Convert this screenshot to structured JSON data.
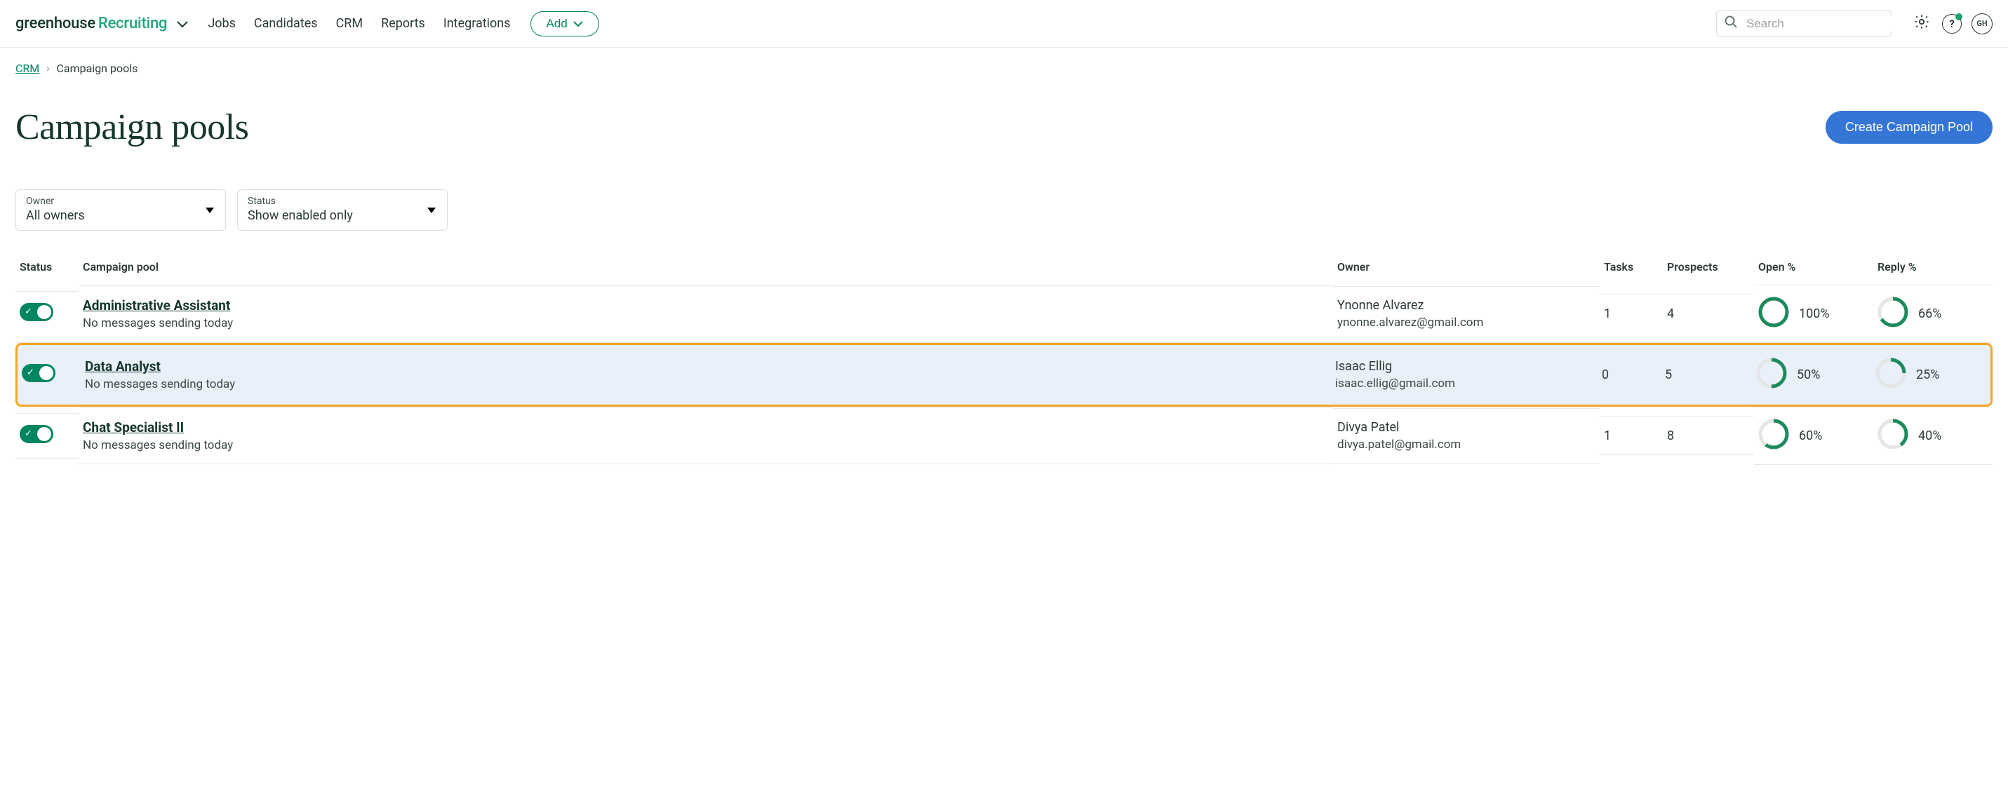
{
  "brand": {
    "word1": "greenhouse",
    "word2": "Recruiting"
  },
  "nav": {
    "jobs": "Jobs",
    "candidates": "Candidates",
    "crm": "CRM",
    "reports": "Reports",
    "integrations": "Integrations"
  },
  "add_label": "Add",
  "search": {
    "placeholder": "Search"
  },
  "avatar_initials": "GH",
  "breadcrumb": {
    "root": "CRM",
    "current": "Campaign pools"
  },
  "page_title": "Campaign pools",
  "create_button": "Create Campaign Pool",
  "filters": {
    "owner": {
      "label": "Owner",
      "value": "All owners"
    },
    "status": {
      "label": "Status",
      "value": "Show enabled only"
    }
  },
  "columns": {
    "status": "Status",
    "pool": "Campaign pool",
    "owner": "Owner",
    "tasks": "Tasks",
    "prospects": "Prospects",
    "open": "Open %",
    "reply": "Reply %"
  },
  "rows": [
    {
      "enabled": true,
      "name": "Administrative Assistant",
      "sub": "No messages sending today",
      "owner_name": "Ynonne Alvarez",
      "owner_email": "ynonne.alvarez@gmail.com",
      "tasks": "1",
      "prospects": "4",
      "open_pct": 100,
      "open_label": "100%",
      "reply_pct": 66,
      "reply_label": "66%",
      "highlight": false
    },
    {
      "enabled": true,
      "name": "Data Analyst",
      "sub": "No messages sending today",
      "owner_name": "Isaac Ellig",
      "owner_email": "isaac.ellig@gmail.com",
      "tasks": "0",
      "prospects": "5",
      "open_pct": 50,
      "open_label": "50%",
      "reply_pct": 25,
      "reply_label": "25%",
      "highlight": true
    },
    {
      "enabled": true,
      "name": "Chat Specialist II",
      "sub": "No messages sending today",
      "owner_name": "Divya Patel",
      "owner_email": "divya.patel@gmail.com",
      "tasks": "1",
      "prospects": "8",
      "open_pct": 60,
      "open_label": "60%",
      "reply_pct": 40,
      "reply_label": "40%",
      "highlight": false
    }
  ]
}
